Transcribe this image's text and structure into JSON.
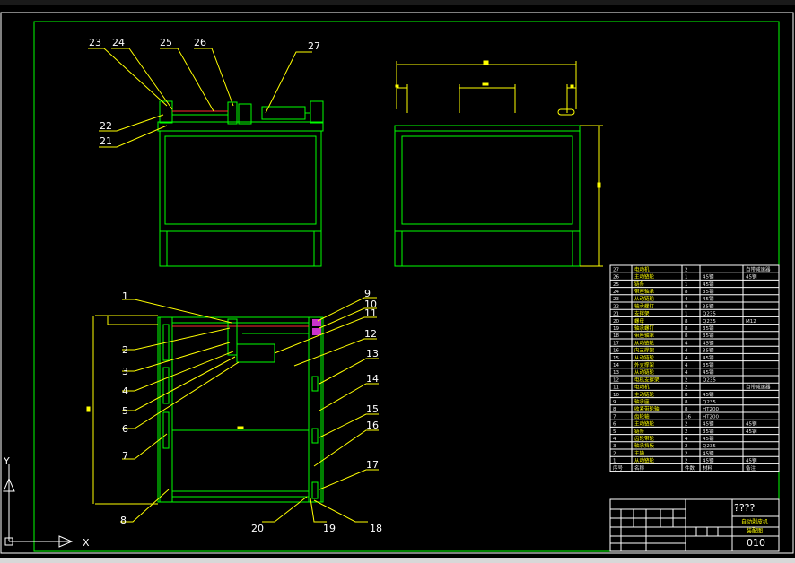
{
  "drawing": {
    "title_marks": "????",
    "drawing_number": "010",
    "drawing_name": "自动剥皮机",
    "drawing_subname": "装配图"
  },
  "callouts": {
    "top_view": [
      "23",
      "24",
      "25",
      "26",
      "27",
      "22",
      "21"
    ],
    "plan_left": [
      "1",
      "2",
      "3",
      "4",
      "5",
      "6",
      "7",
      "8"
    ],
    "plan_right": [
      "9",
      "10",
      "11",
      "12",
      "13",
      "14",
      "15",
      "16",
      "17"
    ],
    "plan_bottom": [
      "20",
      "19",
      "18"
    ]
  },
  "bom": {
    "rows": [
      {
        "no": "27",
        "name": "电动机",
        "qty": "2",
        "mat": "",
        "note": "自带减速器"
      },
      {
        "no": "26",
        "name": "主动链轮",
        "qty": "1",
        "mat": "45钢",
        "note": "45钢"
      },
      {
        "no": "25",
        "name": "链条",
        "qty": "1",
        "mat": "45钢",
        "note": ""
      },
      {
        "no": "24",
        "name": "带座轴承",
        "qty": "8",
        "mat": "35钢",
        "note": ""
      },
      {
        "no": "23",
        "name": "从动链轮",
        "qty": "4",
        "mat": "45钢",
        "note": ""
      },
      {
        "no": "22",
        "name": "轴承螺钉",
        "qty": "8",
        "mat": "35钢",
        "note": ""
      },
      {
        "no": "21",
        "name": "支撑架",
        "qty": "1",
        "mat": "Q235",
        "note": ""
      },
      {
        "no": "20",
        "name": "螺母",
        "qty": "8",
        "mat": "Q235",
        "note": "M12"
      },
      {
        "no": "19",
        "name": "轴承螺钉",
        "qty": "8",
        "mat": "35钢",
        "note": ""
      },
      {
        "no": "18",
        "name": "带座轴承",
        "qty": "8",
        "mat": "35钢",
        "note": ""
      },
      {
        "no": "17",
        "name": "从动链轮",
        "qty": "4",
        "mat": "45钢",
        "note": ""
      },
      {
        "no": "16",
        "name": "内支撑架",
        "qty": "4",
        "mat": "35钢",
        "note": ""
      },
      {
        "no": "15",
        "name": "从动链轮",
        "qty": "4",
        "mat": "45钢",
        "note": ""
      },
      {
        "no": "14",
        "name": "外支撑架",
        "qty": "4",
        "mat": "35钢",
        "note": ""
      },
      {
        "no": "13",
        "name": "从动链轮",
        "qty": "4",
        "mat": "45钢",
        "note": ""
      },
      {
        "no": "12",
        "name": "电机支撑架",
        "qty": "2",
        "mat": "Q235",
        "note": ""
      },
      {
        "no": "11",
        "name": "电动机",
        "qty": "2",
        "mat": "",
        "note": "自带减速器"
      },
      {
        "no": "10",
        "name": "主动链轮",
        "qty": "8",
        "mat": "45钢",
        "note": ""
      },
      {
        "no": "9",
        "name": "轴承座",
        "qty": "8",
        "mat": "Q235",
        "note": ""
      },
      {
        "no": "8",
        "name": "收紧带轮轴",
        "qty": "8",
        "mat": "HT200",
        "note": ""
      },
      {
        "no": "7",
        "name": "齿轮轴",
        "qty": "16",
        "mat": "HT200",
        "note": ""
      },
      {
        "no": "6",
        "name": "主动链轮",
        "qty": "2",
        "mat": "45钢",
        "note": "45钢"
      },
      {
        "no": "5",
        "name": "链条",
        "qty": "2",
        "mat": "35钢",
        "note": "45钢"
      },
      {
        "no": "4",
        "name": "齿轮带轮",
        "qty": "4",
        "mat": "45钢",
        "note": ""
      },
      {
        "no": "3",
        "name": "轴承挡板",
        "qty": "2",
        "mat": "Q235",
        "note": ""
      },
      {
        "no": "2",
        "name": "主轴",
        "qty": "2",
        "mat": "45钢",
        "note": ""
      },
      {
        "no": "1",
        "name": "从动链轮",
        "qty": "2",
        "mat": "45钢",
        "note": "45钢"
      }
    ],
    "header": {
      "no": "序号",
      "name": "名称",
      "qty": "件数",
      "mat": "材料",
      "note": "备注"
    }
  },
  "axes_icon": {
    "y": "Y",
    "x": "X"
  }
}
